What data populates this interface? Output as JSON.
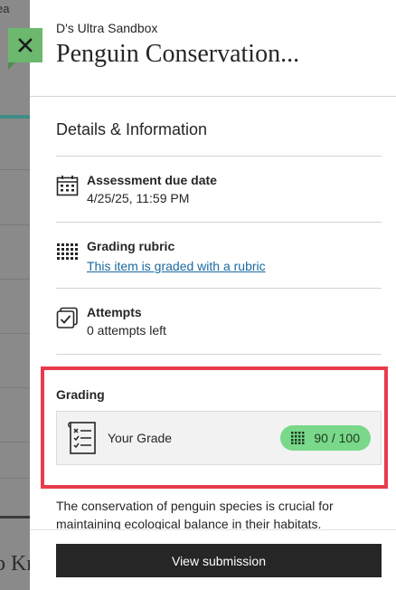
{
  "background": {
    "top_text": "ea",
    "bottom_text": "o Kn"
  },
  "panel": {
    "course_name": "D's Ultra Sandbox",
    "title": "Penguin Conservation..."
  },
  "details": {
    "section_title": "Details & Information",
    "due_date": {
      "label": "Assessment due date",
      "value": "4/25/25, 11:59 PM",
      "icon": "calendar-icon"
    },
    "rubric": {
      "label": "Grading rubric",
      "link_text": "This item is graded with a rubric",
      "icon": "rubric-icon"
    },
    "attempts": {
      "label": "Attempts",
      "value": "0 attempts left",
      "icon": "attempts-icon"
    }
  },
  "grading": {
    "title": "Grading",
    "card_label": "Your Grade",
    "grade_value": "90 / 100",
    "pill_color": "#79d88a",
    "icon": "grade-sheet-icon"
  },
  "description": {
    "text": "The conservation of penguin species is crucial for maintaining ecological balance in their habitats."
  },
  "footer": {
    "button_label": "View submission"
  },
  "colors": {
    "close_button": "#6bb86e",
    "highlight_border": "#e83b4c",
    "link": "#1a6a9e",
    "primary_button": "#262626"
  }
}
